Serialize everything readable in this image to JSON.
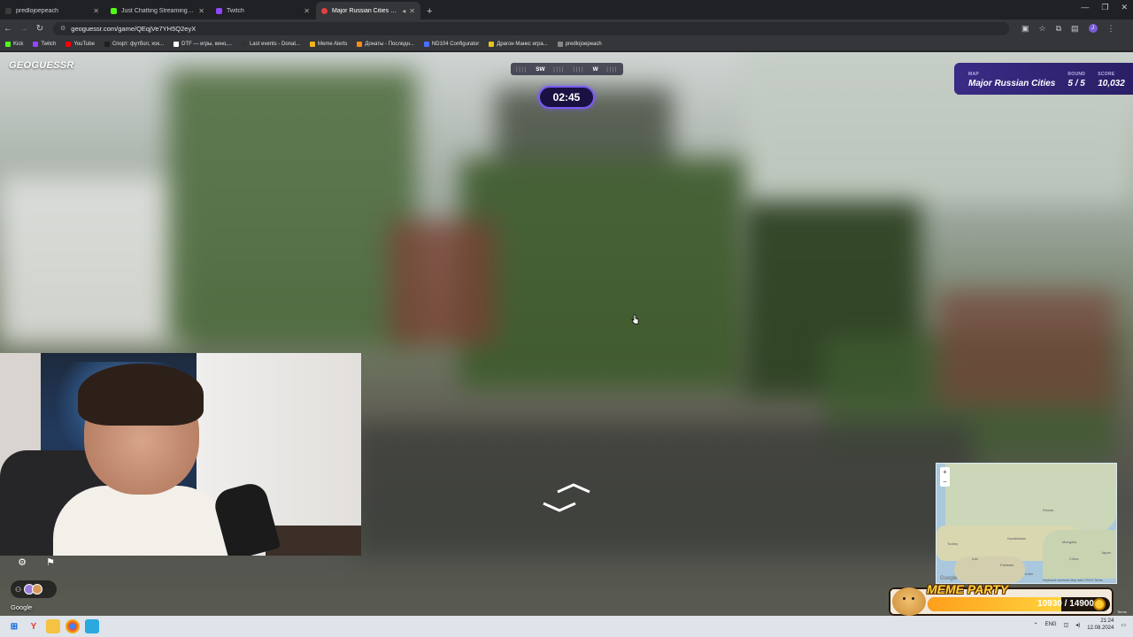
{
  "browser": {
    "tabs": [
      {
        "title": "predlojoepeach",
        "favicon_color": "#3b3b3b",
        "active": false
      },
      {
        "title": "Just Chatting Streaming - Live",
        "favicon_color": "#53fc18",
        "active": false
      },
      {
        "title": "Twitch",
        "favicon_color": "#9146ff",
        "active": false
      },
      {
        "title": "Major Russian Cities - Gam",
        "favicon_color": "#e43f3f",
        "active": true
      }
    ],
    "new_tab": "+",
    "url": "geoguessr.com/game/QEqjVe7YH5Q2eyX",
    "bookmarks": [
      {
        "label": "Kick",
        "color": "#53fc18"
      },
      {
        "label": "Twitch",
        "color": "#9146ff"
      },
      {
        "label": "YouTube",
        "color": "#ff0000"
      },
      {
        "label": "Спорт: футбол, хок...",
        "color": "#1f1f1f"
      },
      {
        "label": "DTF — игры, кино,...",
        "color": "#ffffff"
      },
      {
        "label": "Last events - Donat...",
        "color": "#333333"
      },
      {
        "label": "Meme Alerts",
        "color": "#f7b21a"
      },
      {
        "label": "Донаты - Последн...",
        "color": "#ff8a1f"
      },
      {
        "label": "ND104 Configurator",
        "color": "#4b6fff"
      },
      {
        "label": "Драгон Манкс игра...",
        "color": "#e7c21c"
      },
      {
        "label": "predlojoepeach",
        "color": "#888888"
      }
    ]
  },
  "game": {
    "logo": "GEOGUESSR",
    "logo_pin": "◉",
    "compass": {
      "left": "SW",
      "right": "W",
      "ticks": "||||"
    },
    "timer": "02:45",
    "status": {
      "map_label": "MAP",
      "map_value": "Major Russian Cities",
      "round_label": "ROUND",
      "round_value": "5 / 5",
      "score_label": "SCORE",
      "score_value": "10,032"
    },
    "google": "Google"
  },
  "minimap": {
    "zoom_in": "+",
    "zoom_out": "−",
    "labels": [
      "Russia",
      "Kazakhstan",
      "Mongolia",
      "China",
      "Turkey",
      "Iran",
      "Pakistan",
      "India",
      "Japan"
    ],
    "google": "Google",
    "attribution": "Keyboard shortcuts   Map data ©2024   Terms"
  },
  "meme_party": {
    "title": "MEME PARTY",
    "current": "10930",
    "goal": "14900",
    "value_text": "10930 / 14900",
    "progress": 0.7336,
    "small_text": "Terms"
  },
  "taskbar": {
    "language": "ENG",
    "time": "21:24",
    "date": "12.08.2024"
  },
  "colors": {
    "accent": "#7b5cf1",
    "status_bg": "#3a2b86",
    "meme_yellow": "#ffd23d"
  }
}
